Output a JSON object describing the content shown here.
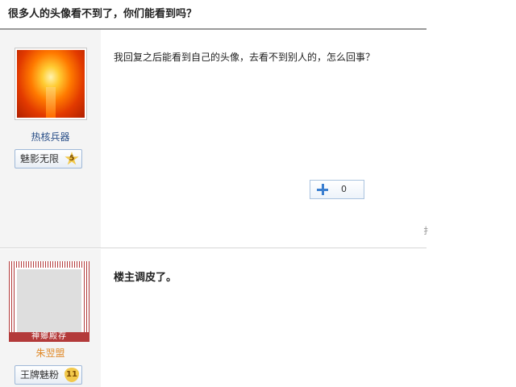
{
  "thread": {
    "title": "很多人的头像看不到了，你们能看到吗？"
  },
  "posts": [
    {
      "username": "热核兵器",
      "badge": {
        "label": "魅影无限",
        "level": "5"
      },
      "text": "我回复之后能看到自己的头像，去看不到别人的，怎么回事？",
      "plus_count": "0",
      "edge_glyph": "扌"
    },
    {
      "username": "朱翌盟",
      "avatar_caption": "神鄉殿存",
      "badge": {
        "label": "王牌魅粉",
        "level": "11"
      },
      "text": "楼主调皮了。"
    }
  ],
  "colors": {
    "username_blue": "#2a4f88",
    "username_orange": "#e08a2a",
    "avatar_frame_red": "#b33a3a",
    "plus_blue": "#3b7fd0"
  },
  "icons": [
    "plus-icon",
    "star-level-icon",
    "heart-level-icon"
  ]
}
